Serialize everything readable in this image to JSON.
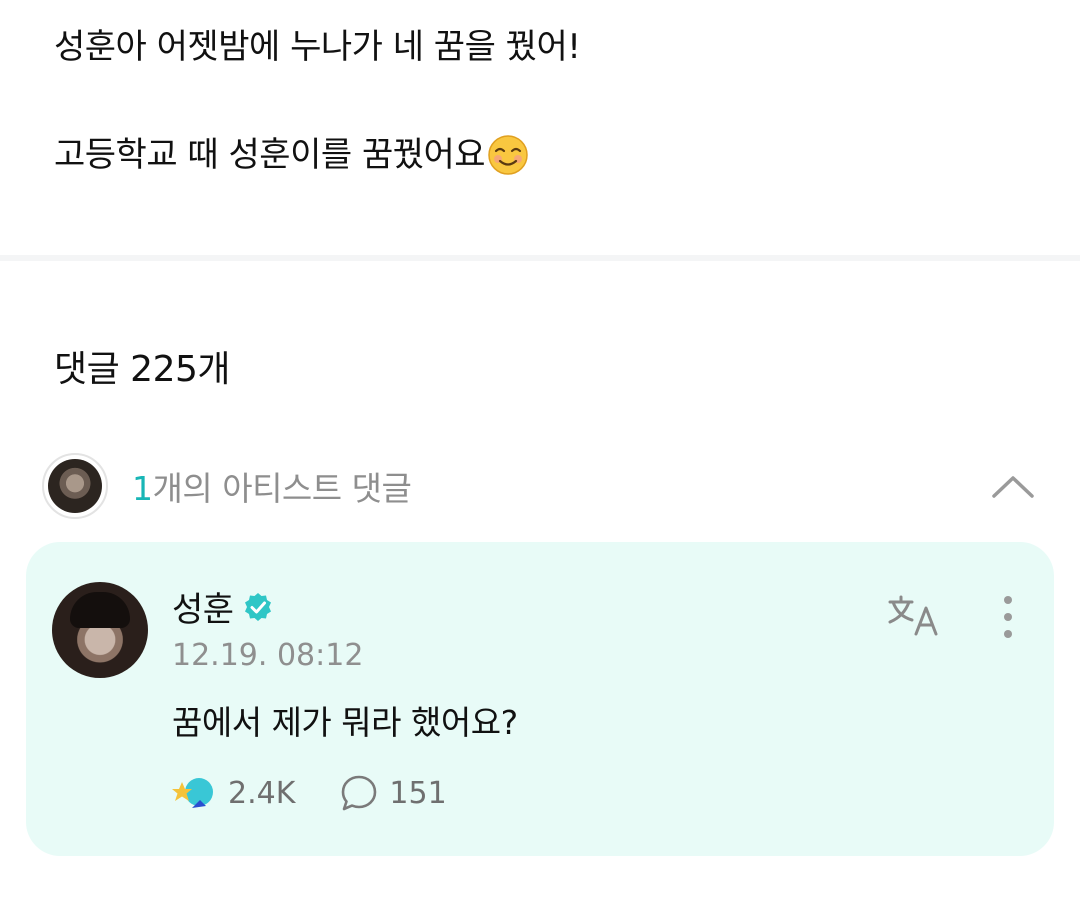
{
  "post": {
    "line1": "성훈아 어젯밤에 누나가 네 꿈을 꿨어!",
    "line2": "고등학교 때 성훈이를 꿈꿨어요"
  },
  "comments": {
    "title": "댓글 225개",
    "artist_count": "1",
    "artist_label": "개의 아티스트 댓글"
  },
  "comment": {
    "author": "성훈",
    "timestamp": "12.19. 08:12",
    "text": "꿈에서 제가 뭐라 했어요?",
    "likes": "2.4K",
    "replies": "151"
  },
  "icons": {
    "emoji": "smiling-face-icon",
    "chevron": "chevron-up-icon",
    "verified": "verified-badge-icon",
    "translate": "translate-icon",
    "more": "more-vertical-icon",
    "fan": "fan-reaction-icon",
    "reply": "speech-bubble-icon"
  },
  "colors": {
    "accent": "#18b6b6",
    "card_background": "#e8fbf7",
    "muted_text": "#8e8e8e"
  }
}
